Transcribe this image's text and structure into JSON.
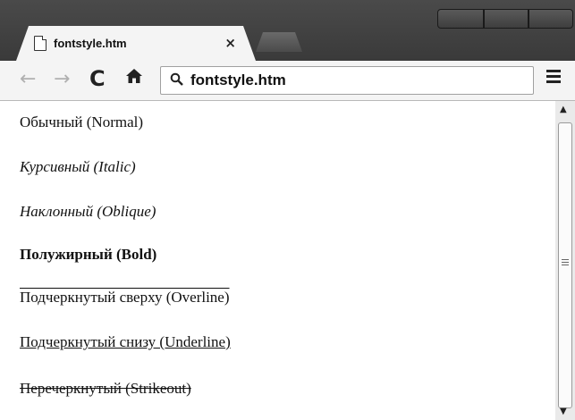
{
  "tab": {
    "title": "fontstyle.htm",
    "close": "×"
  },
  "toolbar": {
    "back": "←",
    "forward": "→",
    "reload": "C",
    "home": "🏠",
    "address": "fontstyle.htm"
  },
  "content": {
    "normal": "Обычный (Normal)",
    "italic": "Курсивный (Italic)",
    "oblique": "Наклонный (Oblique)",
    "bold": "Полужирный (Bold)",
    "overline": "Подчеркнутый сверху (Overline)",
    "underline": "Подчеркнутый снизу (Underline)",
    "strikeout": "Перечеркнутый (Strikeout)"
  },
  "icons": {
    "page": "page-icon",
    "search": "search-icon",
    "menu": "menu-icon"
  }
}
